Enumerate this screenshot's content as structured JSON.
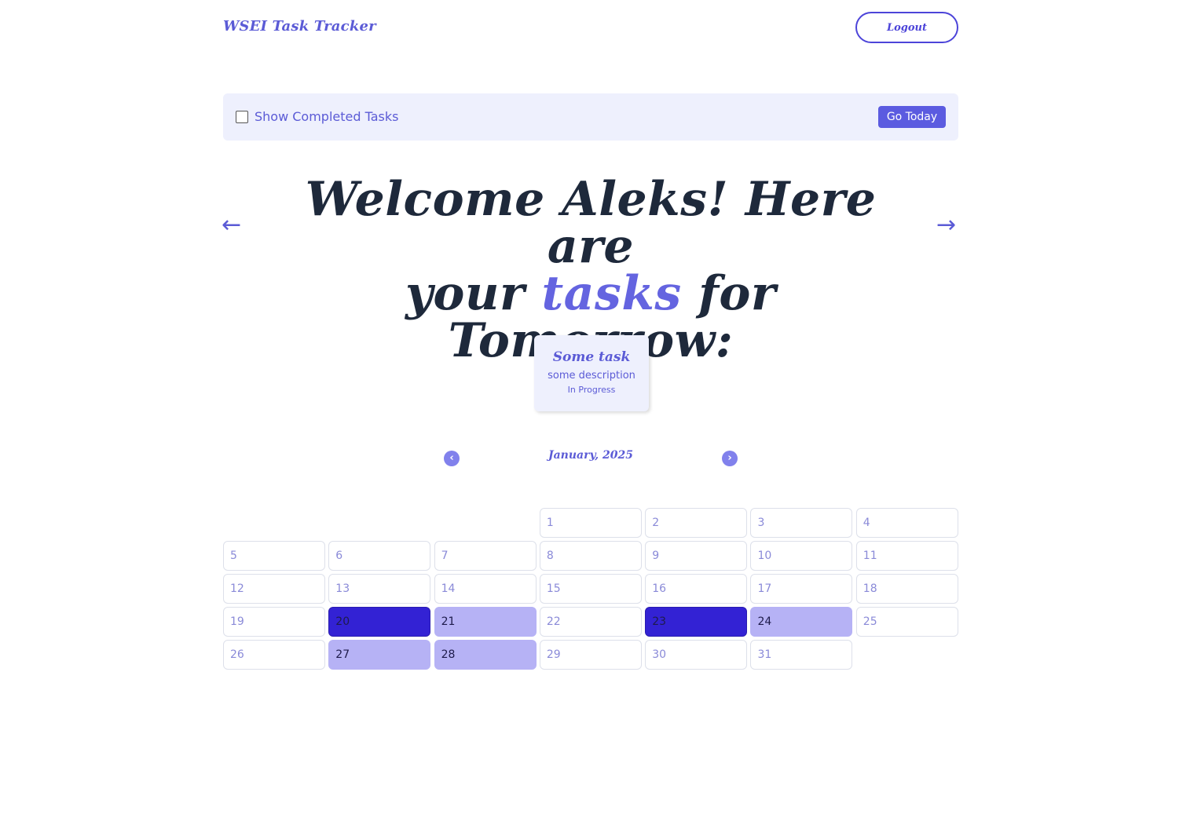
{
  "header": {
    "brand": "WSEI Task Tracker",
    "logout_label": "Logout"
  },
  "toolbar": {
    "show_completed_label": "Show Completed Tasks",
    "show_completed_checked": false,
    "go_today_label": "Go Today"
  },
  "headline": {
    "part1": "Welcome Aleks! Here are",
    "part2": "your",
    "accent": "tasks",
    "part3": "for Tomorrow:",
    "prev_arrow": "←",
    "next_arrow": "→"
  },
  "task": {
    "title": "Some task",
    "description": "some description",
    "status": "In Progress"
  },
  "calendar": {
    "month_label": "January, 2025",
    "prev_icon": "chevron-left-icon",
    "next_icon": "chevron-right-icon",
    "leading_blanks": 3,
    "days": [
      "1",
      "2",
      "3",
      "4",
      "5",
      "6",
      "7",
      "8",
      "9",
      "10",
      "11",
      "12",
      "13",
      "14",
      "15",
      "16",
      "17",
      "18",
      "19",
      "20",
      "21",
      "22",
      "23",
      "24",
      "25",
      "26",
      "27",
      "28",
      "29",
      "30",
      "31"
    ],
    "highlight_dark": [
      "20",
      "23"
    ],
    "highlight_light": [
      "21",
      "24",
      "27",
      "28"
    ]
  },
  "colors": {
    "accent": "#5b5bd6",
    "dark_highlight": "#3322d4",
    "light_highlight": "#b6b2f5",
    "toolbar_bg": "#eef0fd"
  }
}
